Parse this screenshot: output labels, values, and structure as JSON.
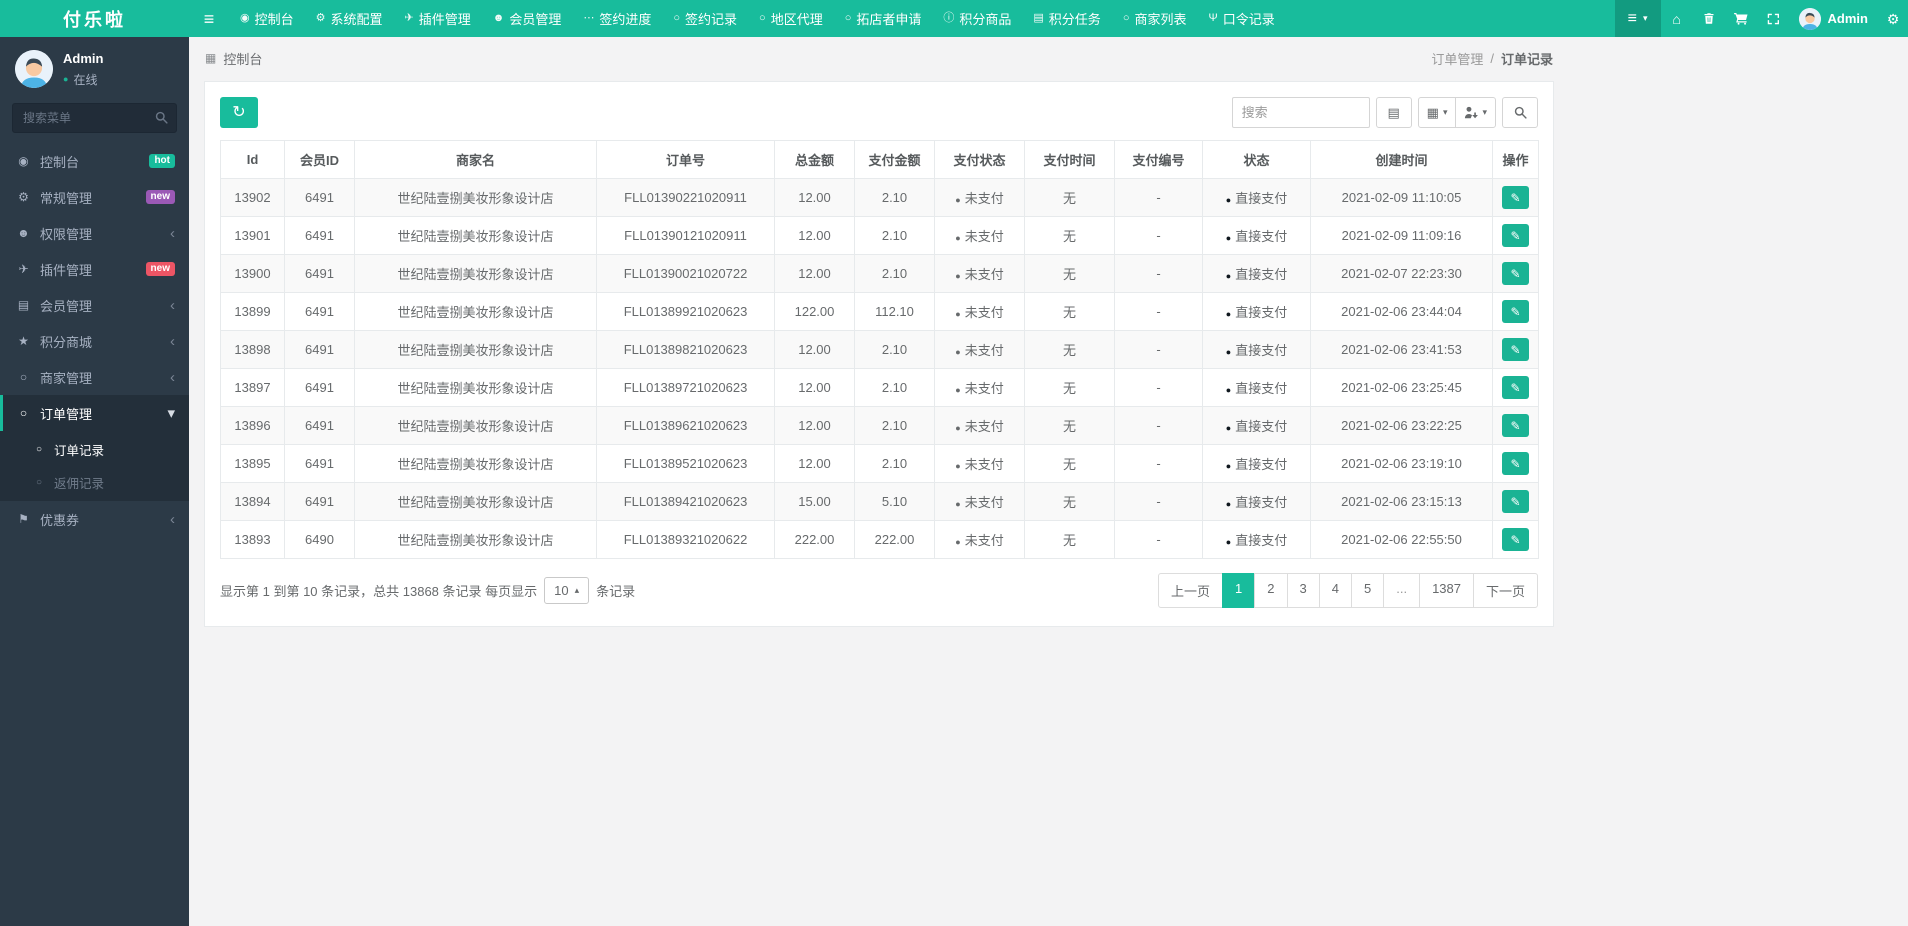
{
  "colors": {
    "accent": "#18bc9c",
    "navbar_bg": "#18bc9c",
    "sidebar_bg": "#2c3a47",
    "unpaid_text": "#1c84c6",
    "badge_hot": "#18bc9c",
    "badge_new_purple": "#9b59b6",
    "badge_new_red": "#ed5565",
    "edit_button": "#1ab394"
  },
  "icons": {
    "hamburger": "≡",
    "gauge": "◉",
    "gear": "⚙",
    "plane": "✈",
    "users": "☻",
    "ellipsis": "⋯",
    "circle": "○",
    "info": "ⓘ",
    "list": "▤",
    "grid": "▦",
    "fork": "Ψ",
    "home": "⌂",
    "star": "★",
    "flag": "⚑",
    "refresh": "↻",
    "pencil": "✎",
    "caret-down": "▾",
    "caret-up": "▴",
    "chevron-left": "‹",
    "chevron-down": "▾",
    "dot": "●"
  },
  "navbar": {
    "brand": "付乐啦",
    "menu": [
      {
        "label": "控制台",
        "icon": "gauge"
      },
      {
        "label": "系统配置",
        "icon": "gear"
      },
      {
        "label": "插件管理",
        "icon": "plane"
      },
      {
        "label": "会员管理",
        "icon": "users"
      },
      {
        "label": "签约进度",
        "icon": "ellipsis"
      },
      {
        "label": "签约记录",
        "icon": "circle"
      },
      {
        "label": "地区代理",
        "icon": "circle"
      },
      {
        "label": "拓店者申请",
        "icon": "circle"
      },
      {
        "label": "积分商品",
        "icon": "info"
      },
      {
        "label": "积分任务",
        "icon": "list"
      },
      {
        "label": "商家列表",
        "icon": "circle"
      },
      {
        "label": "口令记录",
        "icon": "fork"
      }
    ],
    "right_icons": [
      "home",
      "trash",
      "cart",
      "expand"
    ],
    "user_name": "Admin"
  },
  "sidebar": {
    "profile": {
      "name": "Admin",
      "status": "在线"
    },
    "search_placeholder": "搜索菜单",
    "items": [
      {
        "label": "控制台",
        "icon": "gauge",
        "badge": {
          "text": "hot",
          "color": "badge_hot"
        }
      },
      {
        "label": "常规管理",
        "icon": "gear",
        "badge": {
          "text": "new",
          "color": "badge_new_purple"
        }
      },
      {
        "label": "权限管理",
        "icon": "users",
        "chevron": "left"
      },
      {
        "label": "插件管理",
        "icon": "plane",
        "badge": {
          "text": "new",
          "color": "badge_new_red"
        }
      },
      {
        "label": "会员管理",
        "icon": "list",
        "chevron": "left"
      },
      {
        "label": "积分商城",
        "icon": "star",
        "chevron": "left"
      },
      {
        "label": "商家管理",
        "icon": "circle",
        "chevron": "left"
      },
      {
        "label": "订单管理",
        "icon": "circle",
        "chevron": "down",
        "active": true,
        "children": [
          {
            "label": "订单记录",
            "active": true
          },
          {
            "label": "返佣记录"
          }
        ]
      },
      {
        "label": "优惠券",
        "icon": "flag",
        "chevron": "left"
      }
    ]
  },
  "breadcrumb": {
    "section_label": "控制台",
    "trail": [
      "订单管理",
      "订单记录"
    ],
    "separator": "/"
  },
  "toolbar": {
    "search_placeholder": "搜索"
  },
  "table": {
    "columns": [
      "Id",
      "会员ID",
      "商家名",
      "订单号",
      "总金额",
      "支付金额",
      "支付状态",
      "支付时间",
      "支付编号",
      "状态",
      "创建时间",
      "操作"
    ],
    "rows": [
      {
        "id": "13902",
        "member_id": "6491",
        "merchant": "世纪陆壹捌美妆形象设计店",
        "order_no": "FLL01390221020911",
        "total": "12.00",
        "paid": "2.10",
        "pay_status": "未支付",
        "pay_time": "无",
        "pay_no": "-",
        "status": "直接支付",
        "created": "2021-02-09 11:10:05"
      },
      {
        "id": "13901",
        "member_id": "6491",
        "merchant": "世纪陆壹捌美妆形象设计店",
        "order_no": "FLL01390121020911",
        "total": "12.00",
        "paid": "2.10",
        "pay_status": "未支付",
        "pay_time": "无",
        "pay_no": "-",
        "status": "直接支付",
        "created": "2021-02-09 11:09:16"
      },
      {
        "id": "13900",
        "member_id": "6491",
        "merchant": "世纪陆壹捌美妆形象设计店",
        "order_no": "FLL01390021020722",
        "total": "12.00",
        "paid": "2.10",
        "pay_status": "未支付",
        "pay_time": "无",
        "pay_no": "-",
        "status": "直接支付",
        "created": "2021-02-07 22:23:30"
      },
      {
        "id": "13899",
        "member_id": "6491",
        "merchant": "世纪陆壹捌美妆形象设计店",
        "order_no": "FLL01389921020623",
        "total": "122.00",
        "paid": "112.10",
        "pay_status": "未支付",
        "pay_time": "无",
        "pay_no": "-",
        "status": "直接支付",
        "created": "2021-02-06 23:44:04"
      },
      {
        "id": "13898",
        "member_id": "6491",
        "merchant": "世纪陆壹捌美妆形象设计店",
        "order_no": "FLL01389821020623",
        "total": "12.00",
        "paid": "2.10",
        "pay_status": "未支付",
        "pay_time": "无",
        "pay_no": "-",
        "status": "直接支付",
        "created": "2021-02-06 23:41:53"
      },
      {
        "id": "13897",
        "member_id": "6491",
        "merchant": "世纪陆壹捌美妆形象设计店",
        "order_no": "FLL01389721020623",
        "total": "12.00",
        "paid": "2.10",
        "pay_status": "未支付",
        "pay_time": "无",
        "pay_no": "-",
        "status": "直接支付",
        "created": "2021-02-06 23:25:45"
      },
      {
        "id": "13896",
        "member_id": "6491",
        "merchant": "世纪陆壹捌美妆形象设计店",
        "order_no": "FLL01389621020623",
        "total": "12.00",
        "paid": "2.10",
        "pay_status": "未支付",
        "pay_time": "无",
        "pay_no": "-",
        "status": "直接支付",
        "created": "2021-02-06 23:22:25"
      },
      {
        "id": "13895",
        "member_id": "6491",
        "merchant": "世纪陆壹捌美妆形象设计店",
        "order_no": "FLL01389521020623",
        "total": "12.00",
        "paid": "2.10",
        "pay_status": "未支付",
        "pay_time": "无",
        "pay_no": "-",
        "status": "直接支付",
        "created": "2021-02-06 23:19:10"
      },
      {
        "id": "13894",
        "member_id": "6491",
        "merchant": "世纪陆壹捌美妆形象设计店",
        "order_no": "FLL01389421020623",
        "total": "15.00",
        "paid": "5.10",
        "pay_status": "未支付",
        "pay_time": "无",
        "pay_no": "-",
        "status": "直接支付",
        "created": "2021-02-06 23:15:13"
      },
      {
        "id": "13893",
        "member_id": "6490",
        "merchant": "世纪陆壹捌美妆形象设计店",
        "order_no": "FLL01389321020622",
        "total": "222.00",
        "paid": "222.00",
        "pay_status": "未支付",
        "pay_time": "无",
        "pay_no": "-",
        "status": "直接支付",
        "created": "2021-02-06 22:55:50"
      }
    ]
  },
  "table_footer": {
    "summary_left": "显示第 1 到第 10 条记录，总共 13868 条记录 每页显示",
    "per_page": "10",
    "summary_right": "条记录",
    "pagination": {
      "prev": "上一页",
      "next": "下一页",
      "pages": [
        "1",
        "2",
        "3",
        "4",
        "5",
        "...",
        "1387"
      ],
      "active": "1"
    }
  }
}
